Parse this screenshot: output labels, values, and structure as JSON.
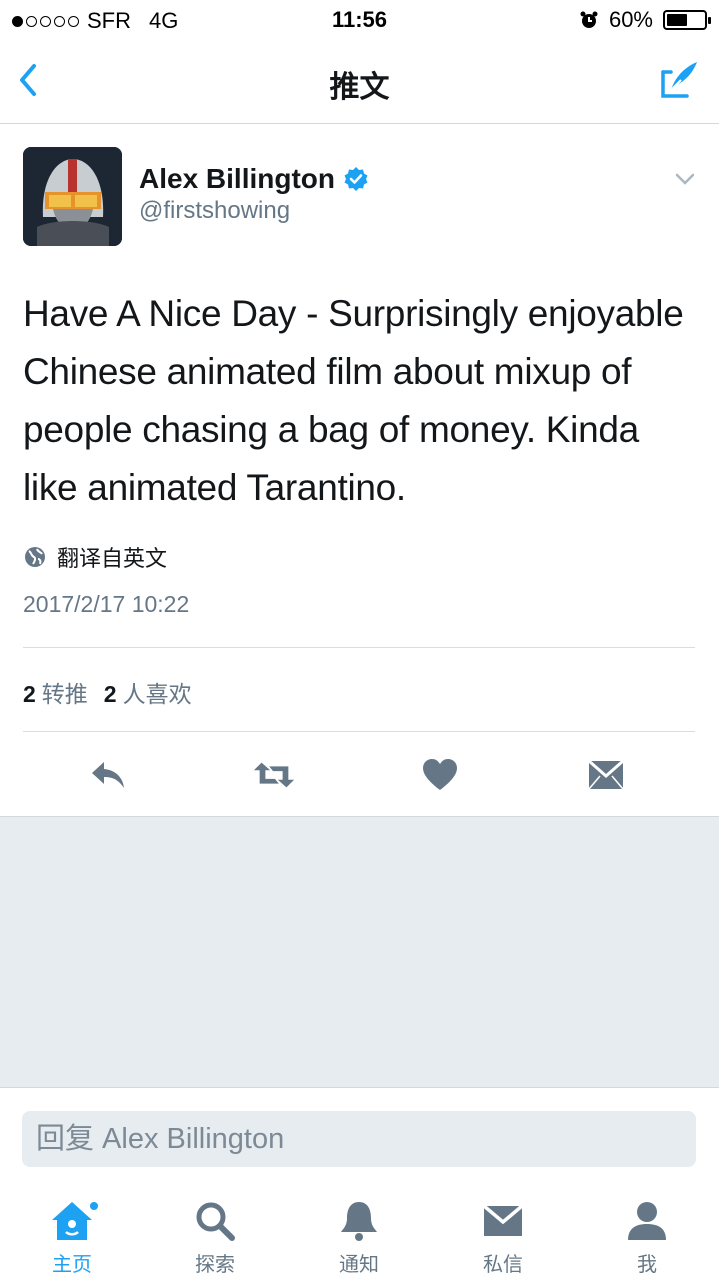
{
  "status_bar": {
    "carrier": "SFR",
    "network": "4G",
    "time": "11:56",
    "battery": "60%",
    "battery_level": 0.6
  },
  "nav": {
    "title": "推文",
    "back_icon": "chevron-left-icon",
    "compose_icon": "compose-tweet-icon"
  },
  "tweet": {
    "author_name": "Alex Billington",
    "handle": "@firstshowing",
    "verified": true,
    "text": "Have A Nice Day - Surprisingly enjoyable Chinese animated film about mixup of people chasing a bag of money. Kinda like animated Tarantino.",
    "translate_label": "翻译自英文",
    "timestamp": "2017/2/17 10:22",
    "retweet_count": "2",
    "retweet_label": "转推",
    "like_count": "2",
    "like_label": "人喜欢"
  },
  "reply": {
    "placeholder": "回复 Alex Billington"
  },
  "tabs": [
    {
      "label": "主页",
      "icon": "home-icon",
      "active": true
    },
    {
      "label": "探索",
      "icon": "search-icon",
      "active": false
    },
    {
      "label": "通知",
      "icon": "bell-icon",
      "active": false
    },
    {
      "label": "私信",
      "icon": "envelope-icon",
      "active": false
    },
    {
      "label": "我",
      "icon": "profile-icon",
      "active": false
    }
  ],
  "colors": {
    "accent": "#1da1f2",
    "icon_gray": "#657786",
    "background_gray": "#e6ecf0"
  }
}
